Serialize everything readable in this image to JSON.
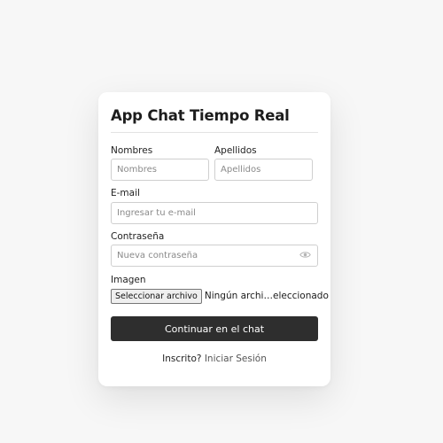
{
  "form": {
    "title": "App Chat Tiempo Real",
    "nombres": {
      "label": "Nombres",
      "placeholder": "Nombres",
      "value": ""
    },
    "apellidos": {
      "label": "Apellidos",
      "placeholder": "Apellidos",
      "value": ""
    },
    "email": {
      "label": "E-mail",
      "placeholder": "Ingresar tu e-mail",
      "value": ""
    },
    "password": {
      "label": "Contraseña",
      "placeholder": "Nueva contraseña",
      "value": "",
      "toggle_icon": "eye-icon"
    },
    "image": {
      "label": "Imagen",
      "button_label": "Seleccionar archivo",
      "status": "Ningún archi…eleccionado"
    },
    "submit_label": "Continuar en el chat",
    "footer": {
      "prompt": "Inscrito?",
      "link": "Iniciar Sesión"
    }
  },
  "colors": {
    "page_background": "#f7f7f7",
    "card_background": "#ffffff",
    "button_background": "#2e2e2e",
    "button_text": "#ffffff"
  }
}
